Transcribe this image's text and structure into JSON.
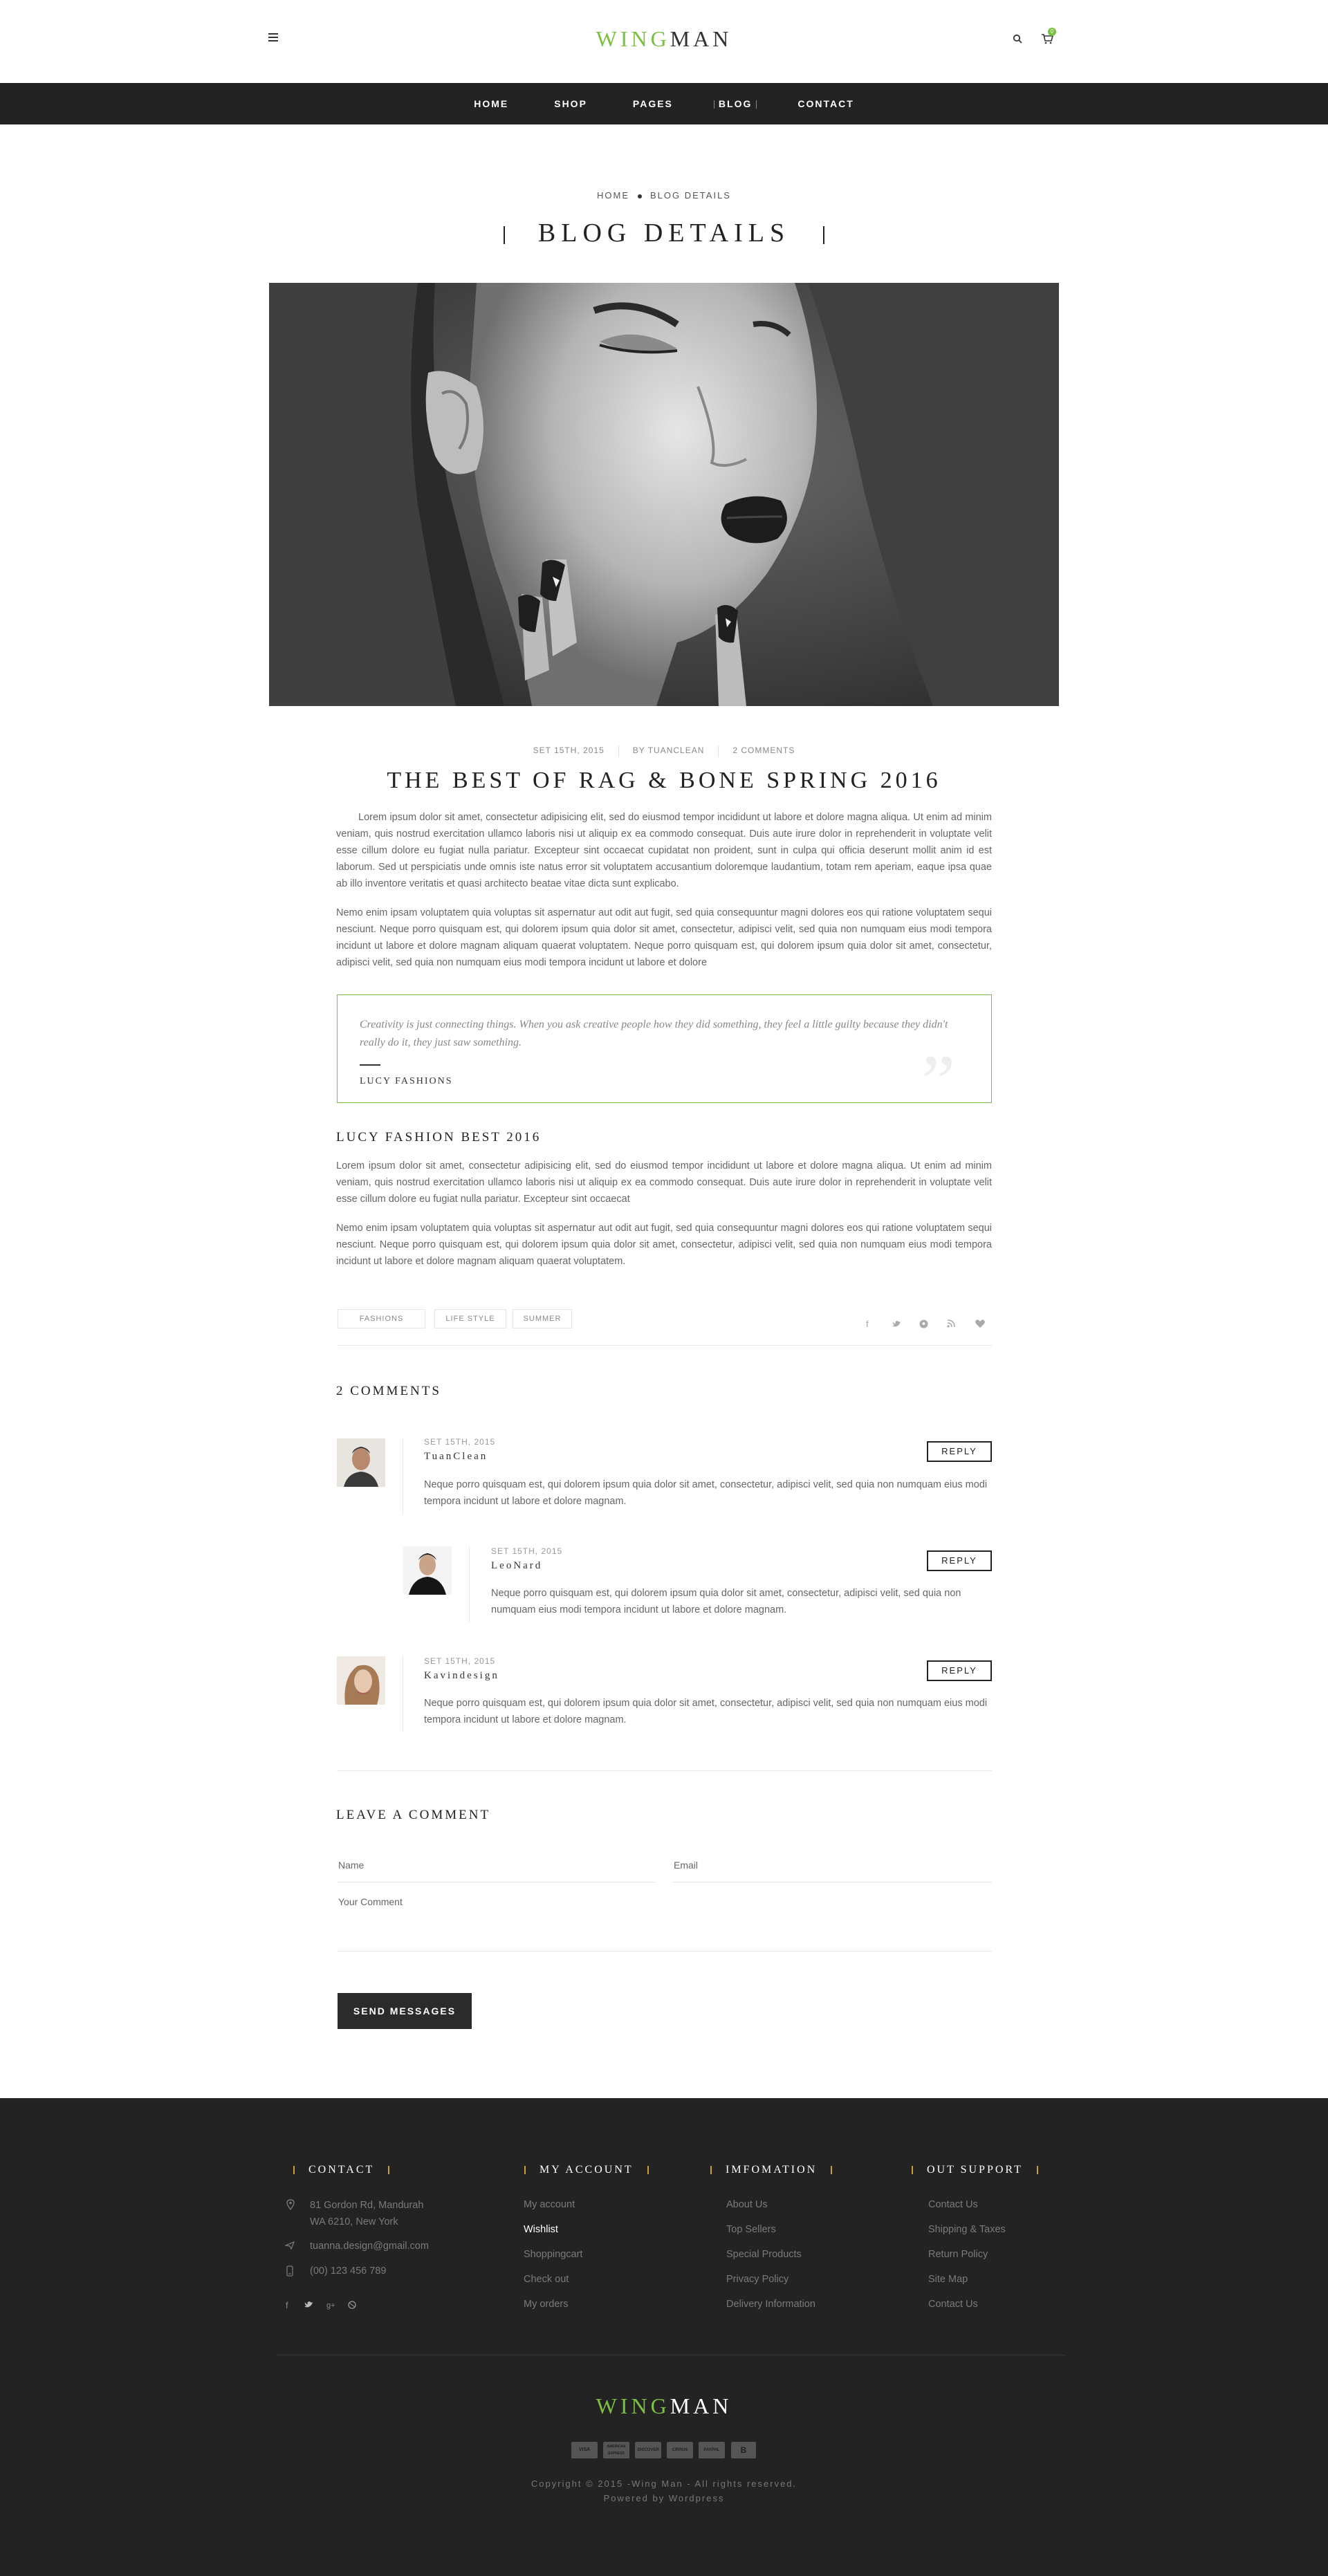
{
  "header": {
    "logo_part1": "WING",
    "logo_part2": "MAN",
    "cart_count": "0",
    "nav": [
      "HOME",
      "SHOP",
      "PAGES",
      "BLOG",
      "CONTACT"
    ],
    "active_nav": "BLOG"
  },
  "page": {
    "breadcrumb_home": "HOME",
    "breadcrumb_current": "BLOG DETAILS",
    "title": "BLOG DETAILS"
  },
  "post": {
    "date": "SET 15TH, 2015",
    "author": "BY TUANCLEAN",
    "comments": "2 COMMENTS",
    "title": "THE BEST OF RAG & BONE SPRING 2016",
    "para1": "Lorem ipsum dolor sit amet, consectetur adipisicing elit, sed do eiusmod tempor incididunt ut labore et dolore magna aliqua. Ut enim ad minim veniam, quis nostrud exercitation ullamco laboris nisi ut aliquip ex ea commodo consequat. Duis aute irure dolor in reprehenderit in voluptate velit esse cillum dolore eu fugiat nulla pariatur. Excepteur sint occaecat cupidatat non proident, sunt in culpa qui officia deserunt mollit anim id est laborum. Sed ut perspiciatis unde omnis iste natus error sit voluptatem accusantium doloremque laudantium, totam rem aperiam, eaque ipsa quae ab illo inventore veritatis et quasi architecto beatae vitae dicta sunt explicabo.",
    "para2": "Nemo enim ipsam voluptatem quia voluptas sit aspernatur aut odit aut fugit, sed quia consequuntur magni dolores eos qui ratione voluptatem sequi nesciunt. Neque porro quisquam est, qui dolorem ipsum quia dolor sit amet, consectetur, adipisci velit, sed quia non numquam eius modi tempora incidunt ut labore et dolore magnam aliquam quaerat voluptatem. Neque porro quisquam est, qui dolorem ipsum quia dolor sit amet, consectetur, adipisci velit, sed quia non numquam eius modi tempora incidunt ut labore et dolore",
    "quote": "Creativity is just connecting things. When you ask creative people how they did something, they feel a little guilty because they didn't really do it, they just saw something.",
    "quote_author": "LUCY FASHIONS",
    "subheading": "LUCY FASHION BEST 2016",
    "para3": "Lorem ipsum dolor sit amet, consectetur adipisicing elit, sed do eiusmod tempor incididunt ut labore et dolore magna aliqua. Ut enim ad minim veniam, quis nostrud exercitation ullamco laboris nisi ut aliquip ex ea commodo consequat. Duis aute irure dolor in reprehenderit in voluptate velit esse cillum dolore eu fugiat nulla pariatur. Excepteur sint occaecat",
    "para4": "Nemo enim ipsam voluptatem quia voluptas sit aspernatur aut odit aut fugit, sed quia consequuntur magni dolores eos qui ratione voluptatem sequi nesciunt. Neque porro quisquam est, qui dolorem ipsum quia dolor sit amet, consectetur, adipisci velit, sed quia non numquam eius modi tempora incidunt ut labore et dolore magnam aliquam quaerat voluptatem.",
    "tags": [
      "FASHIONS",
      "LIFE STYLE",
      "SUMMER"
    ],
    "share_icons": [
      "facebook-icon",
      "twitter-icon",
      "pinterest-icon",
      "rss-icon",
      "heart-icon"
    ]
  },
  "comments": {
    "heading": "2 COMMENTS",
    "reply_label": "REPLY",
    "items": [
      {
        "date": "SET 15TH, 2015",
        "name": "TuanClean",
        "text": "Neque porro quisquam est, qui dolorem ipsum quia dolor sit amet, consectetur, adipisci velit, sed quia non numquam eius modi tempora incidunt ut labore et dolore magnam."
      },
      {
        "date": "SET 15TH, 2015",
        "name": "LeoNard",
        "text": "Neque porro quisquam est, qui dolorem ipsum quia dolor sit amet, consectetur, adipisci velit, sed quia non numquam eius modi tempora incidunt ut labore et dolore magnam."
      },
      {
        "date": "SET 15TH, 2015",
        "name": "Kavindesign",
        "text": "Neque porro quisquam est, qui dolorem ipsum quia dolor sit amet, consectetur, adipisci velit, sed quia non numquam eius modi tempora incidunt ut labore et dolore magnam."
      }
    ]
  },
  "form": {
    "heading": "LEAVE A COMMENT",
    "name_placeholder": "Name",
    "email_placeholder": "Email",
    "comment_placeholder": "Your Comment",
    "submit": "SEND MESSAGES"
  },
  "footer": {
    "contact_title": "CONTACT",
    "address_line1": "81 Gordon Rd, Mandurah",
    "address_line2": "WA 6210, New York",
    "email": "tuanna.design@gmail.com",
    "phone": "(00) 123 456 789",
    "account_title": "MY ACCOUNT",
    "account_links": [
      "My account",
      "Wishlist",
      "Shoppingcart",
      "Check out",
      "My orders"
    ],
    "info_title": "IMFOMATION",
    "info_links": [
      "About Us",
      "Top Sellers",
      "Special Products",
      "Privacy Policy",
      "Delivery Information"
    ],
    "support_title": "OUT SUPPORT",
    "support_links": [
      "Contact Us",
      "Shipping & Taxes",
      "Return Policy",
      "Site Map",
      "Contact Us"
    ],
    "logo_part1": "WING",
    "logo_part2": "MAN",
    "payments": [
      "VISA",
      "AMERICAN EXPRESS",
      "DISCOVER",
      "CIRRUS",
      "PAYPAL",
      "B"
    ],
    "copyright": "Copyright © 2015 -Wing Man - All rights reserved.",
    "powered": "Powered by Wordpress"
  },
  "colors": {
    "accent_green": "#7cc043",
    "dark": "#232323",
    "footer_bar_gold": "#c8a13a"
  }
}
